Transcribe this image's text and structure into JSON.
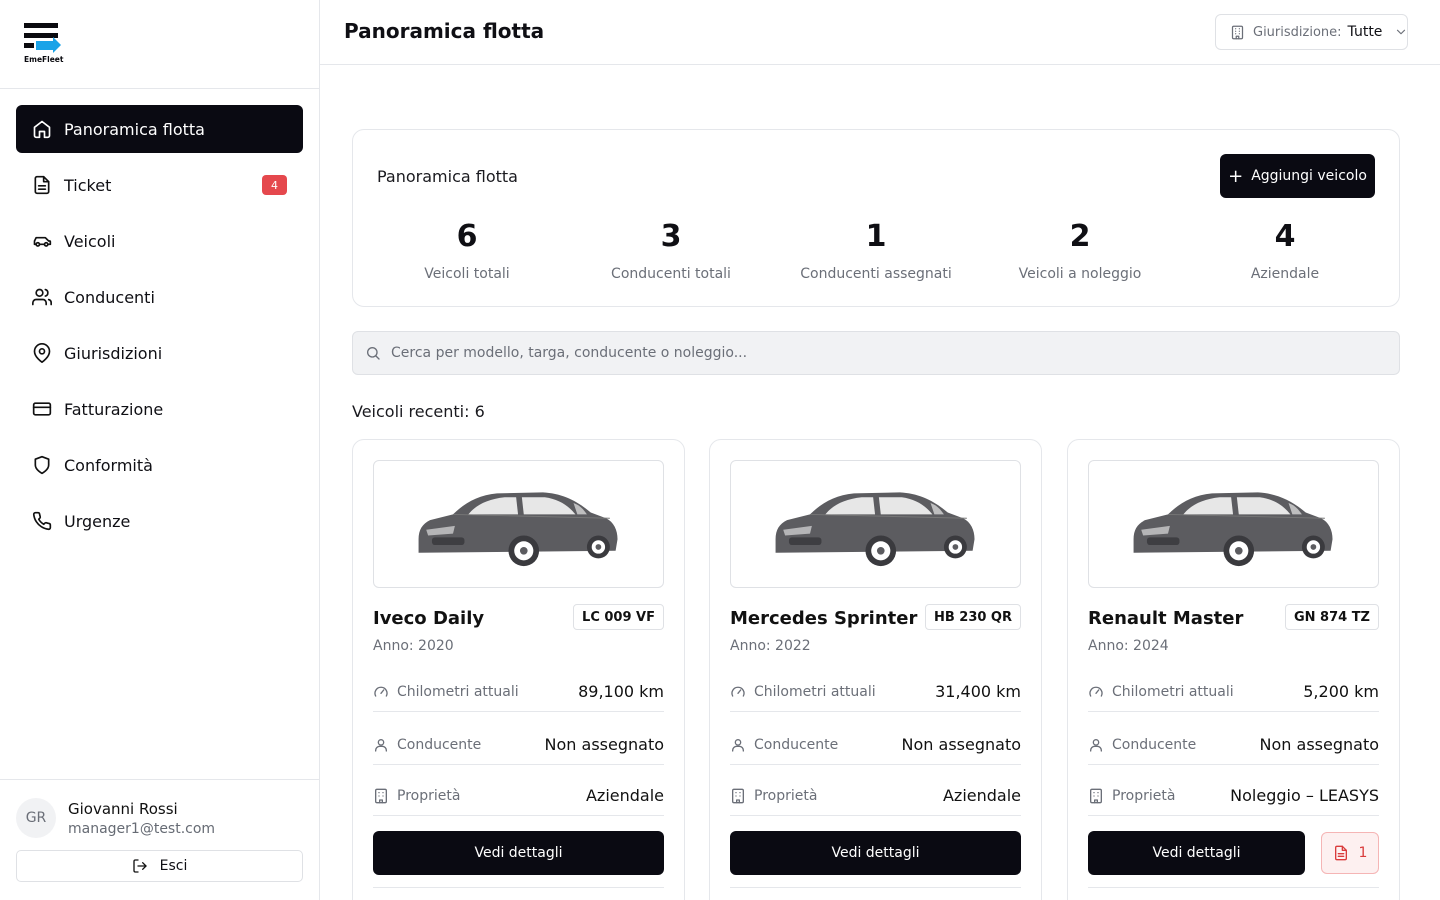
{
  "app": {
    "logo_text": "EmeFleet"
  },
  "sidebar": {
    "items": [
      {
        "label": "Panoramica flotta",
        "icon": "home-icon"
      },
      {
        "label": "Ticket",
        "icon": "file-text-icon",
        "badge": "4"
      },
      {
        "label": "Veicoli",
        "icon": "car-icon"
      },
      {
        "label": "Conducenti",
        "icon": "users-icon"
      },
      {
        "label": "Giurisdizioni",
        "icon": "map-pin-icon"
      },
      {
        "label": "Fatturazione",
        "icon": "credit-card-icon"
      },
      {
        "label": "Conformità",
        "icon": "shield-icon"
      },
      {
        "label": "Urgenze",
        "icon": "phone-icon"
      }
    ]
  },
  "user": {
    "initials": "GR",
    "name": "Giovanni Rossi",
    "email": "manager1@test.com",
    "logout_label": "Esci"
  },
  "header": {
    "title": "Panoramica flotta",
    "jurisdiction_label": "Giurisdizione:",
    "jurisdiction_value": "Tutte"
  },
  "overview": {
    "title": "Panoramica flotta",
    "add_button": "Aggiungi veicolo",
    "stats": [
      {
        "value": "6",
        "label": "Veicoli totali"
      },
      {
        "value": "3",
        "label": "Conducenti totali"
      },
      {
        "value": "1",
        "label": "Conducenti assegnati"
      },
      {
        "value": "2",
        "label": "Veicoli a noleggio"
      },
      {
        "value": "4",
        "label": "Aziendale"
      }
    ]
  },
  "search": {
    "placeholder": "Cerca per modello, targa, conducente o noleggio..."
  },
  "recent_label": "Veicoli recenti: 6",
  "vehicle_labels": {
    "km": "Chilometri attuali",
    "driver": "Conducente",
    "ownership": "Proprietà",
    "details_button": "Vedi dettagli"
  },
  "vehicles": [
    {
      "name": "Iveco Daily",
      "plate": "LC 009 VF",
      "year": "Anno: 2020",
      "km": "89,100 km",
      "driver": "Non assegnato",
      "ownership": "Aziendale"
    },
    {
      "name": "Mercedes Sprinter",
      "plate": "HB 230 QR",
      "year": "Anno: 2022",
      "km": "31,400 km",
      "driver": "Non assegnato",
      "ownership": "Aziendale"
    },
    {
      "name": "Renault Master",
      "plate": "GN 874 TZ",
      "year": "Anno: 2024",
      "km": "5,200 km",
      "driver": "Non assegnato",
      "ownership": "Noleggio – LEASYS",
      "doc_count": "1"
    }
  ],
  "colors": {
    "primary": "#0a0a12",
    "badge": "#e5484d",
    "logo_accent": "#1aa3e8",
    "doc_alert": "#d93b3b"
  }
}
